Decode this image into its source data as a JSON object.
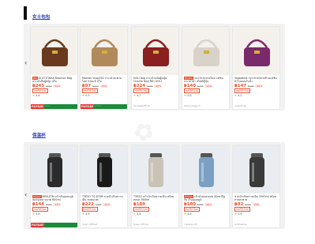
{
  "sections": [
    {
      "title": "女士包包",
      "cards": [
        {
          "tag": "Phi",
          "title": "DOCOTIKKA Dasmon Bag กระเป๋าถือผู้หญิง 4ใบ",
          "price": "฿243",
          "old": "฿369",
          "disc": "-34%",
          "label": "ส่งฟรีทั่วไทย",
          "rating": "4.6",
          "shop": "docotikka.shop",
          "pay": "PAYDAY"
        },
        {
          "tag": "",
          "title": "Manlan shop002 กระเป๋าสะพายไหล่ หนังแท้ 4ใบ",
          "price": "฿97",
          "old": "฿144",
          "disc": "-33%",
          "label": "ส่งฟรีทั่วไทย",
          "rating": "4.9",
          "shop": "manlanshop002",
          "pay": "PAYDAY"
        },
        {
          "tag": "",
          "title": "DOU bag กระเป๋าหนังผู้หญิง Charlie Bag สีดำ DOU",
          "price": "฿224",
          "old": "฿280",
          "disc": "-20%",
          "label": "ส่งฟรีทั่วไทย",
          "rating": "4.7",
          "shop": "doubagofficial",
          "pay": ""
        },
        {
          "tag": "Promo",
          "title": "กระเป๋าสะพายไหล่ แฟชั่น กระเป๋าผ้า สไตล์ญี่ปุ่น",
          "price": "฿140",
          "old": "฿185",
          "disc": "-24%",
          "label": "ส่งฟรีทั่วไทย",
          "rating": "4.8",
          "shop": "fashionbag.th",
          "pay": ""
        },
        {
          "tag": "",
          "title": "Yogodkiss กระเป๋าสะพายข้างแฟชั่น ผ้าไนลอนกันน้ำ",
          "price": "฿147",
          "old": "฿199",
          "disc": "-26%",
          "label": "ส่งฟรีทั่วไทย",
          "rating": "4.5",
          "shop": "yogodkiss",
          "pay": ""
        }
      ]
    },
    {
      "title": "保温杯",
      "cards": [
        {
          "tag": "Promo",
          "title": "BEAUTIN แก้วเก็บอุณหภูมิ สแตนเลส ขนาด 600ml",
          "price": "฿144",
          "old": "฿188",
          "disc": "-23%",
          "label": "ส่งฟรีทั่วไทย",
          "rating": "4.8",
          "shop": "beautin.th",
          "pay": "PAYDAY"
        },
        {
          "tag": "",
          "title": "TYESO TS-8708 ขวดน้ำเก็บความเย็น สแตนเลส",
          "price": "฿222",
          "old": "฿290",
          "disc": "-23%",
          "label": "ส่งฟรีทั่วไทย",
          "rating": "4.9",
          "shop": "tyeso.official",
          "pay": ""
        },
        {
          "tag": "",
          "title": "TYESO แก้วน้ำเก็บความเย็น พร้อมหลอด 900ml",
          "price": "฿189",
          "old": "",
          "disc": "",
          "label": "ส่งฟรีทั่วไทย",
          "rating": "4.8",
          "shop": "tyeso.official",
          "pay": ""
        },
        {
          "tag": "Promo",
          "title": "แก้วน้ำสแตนเลส 40oz มีหูจับ เก็บอุณหภูมิ",
          "price": "฿180",
          "old": "฿250",
          "disc": "-28%",
          "label": "ส่งฟรีทั่วไทย",
          "rating": "4.8",
          "shop": "cupstore.th",
          "pay": ""
        },
        {
          "tag": "",
          "title": "ขวดน้ำเก็บความเย็น 1000ml พร้อมสายสะพาย",
          "price": "฿92",
          "old": "฿125",
          "disc": "-26%",
          "label": "ส่งฟรีทั่วไทย",
          "rating": "4.6",
          "shop": "bottleshop",
          "pay": ""
        }
      ]
    }
  ],
  "colors": {
    "accent": "#ee4d2d",
    "link": "#2a3bbd"
  },
  "icons": {
    "nav": "chevron-left-icon",
    "rating": "star-icon"
  }
}
